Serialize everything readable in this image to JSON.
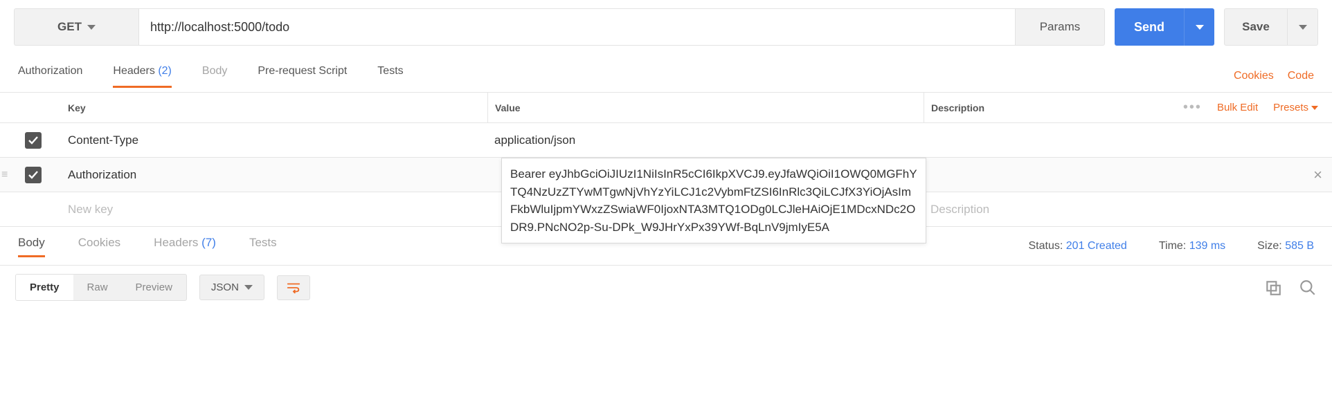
{
  "request": {
    "method": "GET",
    "url": "http://localhost:5000/todo",
    "params_label": "Params",
    "send_label": "Send",
    "save_label": "Save"
  },
  "tabs": {
    "authorization": "Authorization",
    "headers_label": "Headers",
    "headers_count": "(2)",
    "body": "Body",
    "prerequest": "Pre-request Script",
    "tests": "Tests",
    "cookies": "Cookies",
    "code": "Code"
  },
  "headers_table": {
    "key_label": "Key",
    "value_label": "Value",
    "description_label": "Description",
    "bulk_edit": "Bulk Edit",
    "presets": "Presets",
    "rows": [
      {
        "enabled": true,
        "key": "Content-Type",
        "value": "application/json"
      },
      {
        "enabled": true,
        "key": "Authorization",
        "value": "Bearer eyJhbGciOiJIUzI1NiIsInR5cCI6IkpXVCJ9.eyJfaWQiOiI1OWQ0MGFhYTQ4NzUzZTYwMTgwNjVhYzYiLCJ1c2VybmFtZSI6InRlc3QiLCJfX3YiOjAsImFkbWluIjpmYWxzZSwiaWF0IjoxNTA3MTQ1ODg0LCJleHAiOjE1MDcxNDc2ODR9.PNcNO2p-Su-DPk_W9JHrYxPx39YWf-BqLnV9jmIyE5A"
      }
    ],
    "new_key_placeholder": "New key",
    "description_placeholder": "Description"
  },
  "response_tabs": {
    "body": "Body",
    "cookies": "Cookies",
    "headers_label": "Headers",
    "headers_count": "(7)",
    "tests": "Tests"
  },
  "response_meta": {
    "status_label": "Status:",
    "status_value": "201 Created",
    "time_label": "Time:",
    "time_value": "139 ms",
    "size_label": "Size:",
    "size_value": "585 B"
  },
  "body_toolbar": {
    "pretty": "Pretty",
    "raw": "Raw",
    "preview": "Preview",
    "lang": "JSON"
  }
}
